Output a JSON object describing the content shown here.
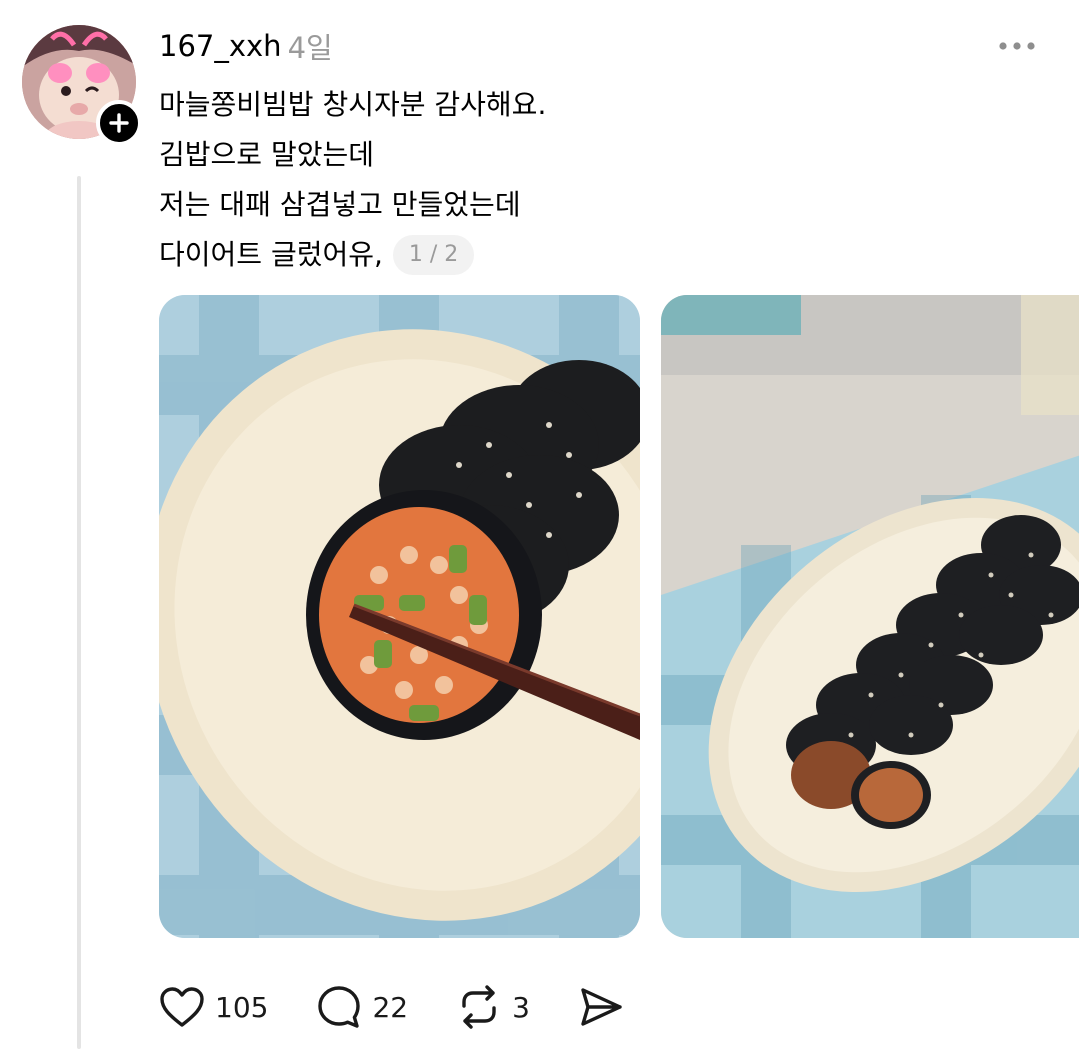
{
  "post": {
    "author": {
      "username": "167_xxh",
      "timestamp": "4일"
    },
    "body_lines": [
      "마늘쫑비빔밥 창시자분 감사해요.",
      "김밥으로 말았는데",
      "저는 대패 삼겹넣고 만들었는데",
      "다이어트 글렀어유,"
    ],
    "media_counter": "1 / 2",
    "icons": {
      "follow": "plus-icon",
      "more": "more-dots-icon",
      "like": "heart-icon",
      "reply": "comment-icon",
      "repost": "repost-icon",
      "share": "send-icon"
    },
    "actions": {
      "likes": "105",
      "replies": "22",
      "reposts": "3"
    },
    "colors": {
      "text": "#000000",
      "muted": "#9a9a9a",
      "thread_line": "#e4e4e4"
    }
  }
}
